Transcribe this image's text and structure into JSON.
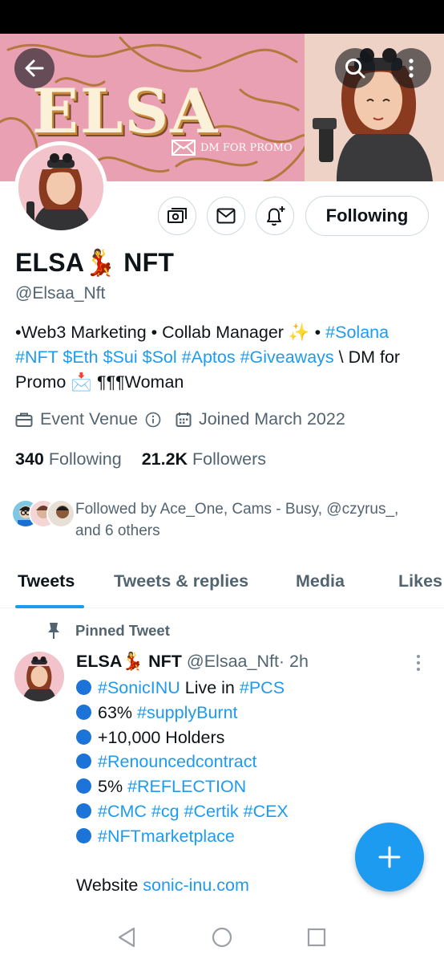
{
  "header": {
    "banner_title": "ELSA",
    "banner_dm_text": "DM FOR PROMO",
    "back_icon": "arrow-left-icon",
    "search_icon": "search-icon",
    "more_icon": "more-vertical-icon"
  },
  "profile": {
    "display_name": "ELSA💃 NFT",
    "handle": "@Elsaa_Nft",
    "following_button": "Following",
    "bio_parts": {
      "p1": "•Web3 Marketing • Collab Manager ✨ • ",
      "solana": "#Solana",
      "nl": "",
      "nft": "#NFT",
      "eth": "$Eth",
      "sui": "$Sui",
      "sol": "$Sol",
      "aptos": "#Aptos",
      "giveaways": "#Giveaways",
      "p2": " \\ DM for Promo 📩 ¶¶¶Woman"
    },
    "location": "Event Venue",
    "joined": "Joined March 2022",
    "following_count": "340",
    "following_label": "Following",
    "followers_count": "21.2K",
    "followers_label": "Followers",
    "followed_by": "Followed by Ace_One, Cams - Busy, @czyrus_, and 6 others"
  },
  "tabs": [
    {
      "label": "Tweets",
      "active": true
    },
    {
      "label": "Tweets & replies",
      "active": false
    },
    {
      "label": "Media",
      "active": false
    },
    {
      "label": "Likes",
      "active": false
    }
  ],
  "pinned_tweet": {
    "pinned_label": "Pinned Tweet",
    "author_name": "ELSA💃 NFT",
    "author_handle": "@Elsaa_Nft",
    "time": "· 2h",
    "lines": [
      {
        "a": "",
        "link": "#SonicINU",
        "b": " Live in ",
        "link2": "#PCS"
      },
      {
        "a": "63% ",
        "link": "#supplyBurnt",
        "b": "",
        "link2": ""
      },
      {
        "a": "+10,000 Holders",
        "link": "",
        "b": "",
        "link2": ""
      },
      {
        "a": "",
        "link": "#Renouncedcontract",
        "b": "",
        "link2": ""
      },
      {
        "a": "5% ",
        "link": "#REFLECTION",
        "b": "",
        "link2": ""
      },
      {
        "a": "",
        "link": "#CMC #cg #Certik #CEX",
        "b": "",
        "link2": ""
      },
      {
        "a": "",
        "link": "#NFTmarketplace",
        "b": "",
        "link2": ""
      }
    ],
    "website_label": "Website ",
    "website_link": "sonic-inu.com"
  },
  "colors": {
    "accent": "#1d9bf0",
    "muted": "#536471",
    "text": "#0f1419"
  }
}
